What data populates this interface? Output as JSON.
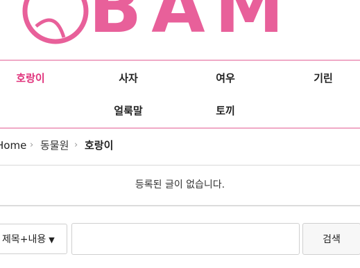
{
  "brand": {
    "logo_text": "BAM",
    "accent_color": "#e8609a",
    "icon": "circle-emblem-icon"
  },
  "nav": {
    "items": [
      {
        "label": "호랑이",
        "active": true
      },
      {
        "label": "사자",
        "active": false
      },
      {
        "label": "여우",
        "active": false
      },
      {
        "label": "기린",
        "active": false
      },
      {
        "label": "얼룩말",
        "active": false
      },
      {
        "label": "토끼",
        "active": false
      }
    ],
    "active_color": "#e0307a"
  },
  "breadcrumb": {
    "home": "Home",
    "separator": "›",
    "category": "동물원",
    "current": "호랑이"
  },
  "board": {
    "empty_message": "등록된 글이 없습니다."
  },
  "search": {
    "scope_selected": "제목+내용",
    "input_value": "",
    "button_label": "검색"
  }
}
